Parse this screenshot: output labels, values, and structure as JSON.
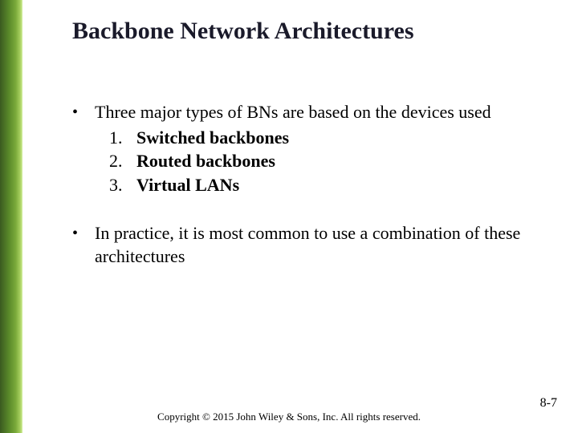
{
  "title": "Backbone Network Architectures",
  "bullets": [
    {
      "lead": "Three major types of BNs are based on the devices used",
      "items": [
        {
          "n": "1.",
          "label": "Switched backbones"
        },
        {
          "n": "2.",
          "label": "Routed backbones"
        },
        {
          "n": "3.",
          "label": "Virtual LANs"
        }
      ]
    },
    {
      "lead": "In practice, it is most common to use a  combination of these architectures",
      "items": []
    }
  ],
  "footer": "Copyright © 2015 John Wiley & Sons, Inc. All rights reserved.",
  "page_number": "8-7"
}
